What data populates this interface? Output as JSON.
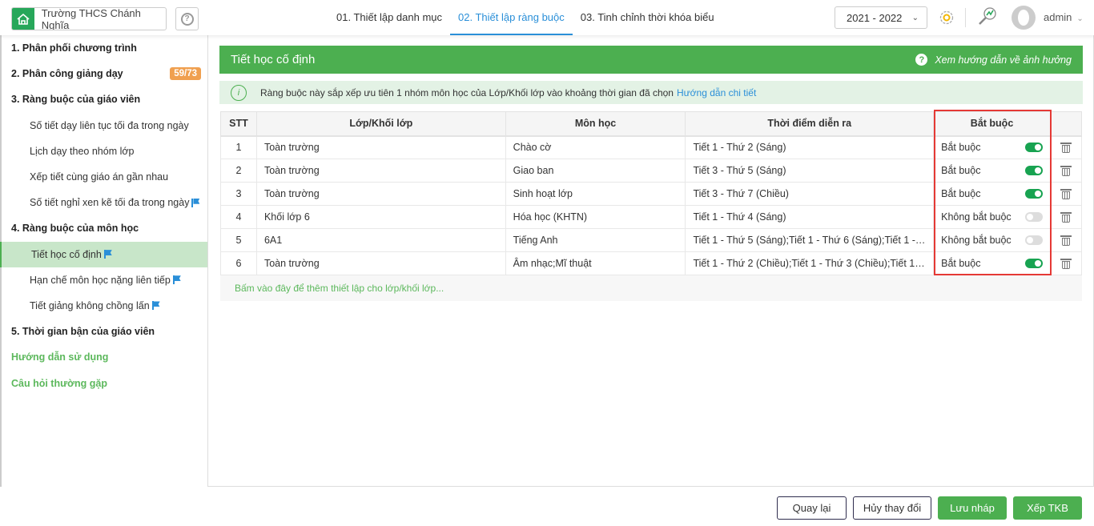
{
  "header": {
    "school": "Trường THCS Chánh Nghĩa",
    "tabs": [
      "01. Thiết lập danh mục",
      "02. Thiết lập ràng buộc",
      "03. Tinh chỉnh thời khóa biểu"
    ],
    "active_tab": 1,
    "year": "2021 - 2022",
    "user": "admin"
  },
  "sidebar": {
    "s1": "1. Phân phối chương trình",
    "s2": "2. Phân công giảng dạy",
    "s2_badge": "59/73",
    "s3": "3. Ràng buộc của giáo viên",
    "s3a": "Số tiết dạy liên tục tối đa trong ngày",
    "s3b": "Lịch dạy theo nhóm lớp",
    "s3c": "Xếp tiết cùng giáo án gần nhau",
    "s3d": "Số tiết nghỉ xen kẽ tối đa trong ngày",
    "s4": "4. Ràng buộc của môn học",
    "s4a": "Tiết học cố định",
    "s4b": "Hạn chế môn học nặng liên tiếp",
    "s4c": "Tiết giảng không chồng lấn",
    "s5": "5. Thời gian bận của giáo viên",
    "guide": "Hướng dẫn sử dụng",
    "faq": "Câu hỏi thường gặp"
  },
  "main": {
    "title": "Tiết học cố định",
    "guide_link": "Xem hướng dẫn về ảnh hưởng",
    "info": "Ràng buộc này sắp xếp ưu tiên 1 nhóm môn học của Lớp/Khối lớp vào khoảng thời gian đã chọn",
    "info_link": "Hướng dẫn chi tiết",
    "columns": [
      "STT",
      "Lớp/Khối lớp",
      "Môn học",
      "Thời điểm diễn ra",
      "Bắt buộc"
    ],
    "rows": [
      {
        "stt": "1",
        "class": "Toàn trường",
        "subject": "Chào cờ",
        "time": "Tiết 1 - Thứ 2 (Sáng)",
        "req": "Bắt buộc",
        "on": true
      },
      {
        "stt": "2",
        "class": "Toàn trường",
        "subject": "Giao ban",
        "time": "Tiết 3 - Thứ 5 (Sáng)",
        "req": "Bắt buộc",
        "on": true
      },
      {
        "stt": "3",
        "class": "Toàn trường",
        "subject": "Sinh hoạt lớp",
        "time": "Tiết 3 - Thứ 7 (Chiều)",
        "req": "Bắt buộc",
        "on": true
      },
      {
        "stt": "4",
        "class": "Khối lớp 6",
        "subject": "Hóa học (KHTN)",
        "time": "Tiết 1 - Thứ 4 (Sáng)",
        "req": "Không bắt buộc",
        "on": false
      },
      {
        "stt": "5",
        "class": "6A1",
        "subject": "Tiếng Anh",
        "time": "Tiết 1 - Thứ 5 (Sáng);Tiết 1 - Thứ 6 (Sáng);Tiết 1 - Th...",
        "req": "Không bắt buộc",
        "on": false
      },
      {
        "stt": "6",
        "class": "Toàn trường",
        "subject": "Âm nhạc;Mĩ thuật",
        "time": "Tiết 1 - Thứ 2 (Chiều);Tiết 1 - Thứ 3 (Chiều);Tiết 1 - T...",
        "req": "Bắt buộc",
        "on": true
      }
    ],
    "add": "Bấm vào đây để thêm thiết lập cho lớp/khối lớp..."
  },
  "footer": {
    "back": "Quay lại",
    "cancel": "Hủy thay đổi",
    "draft": "Lưu nháp",
    "schedule": "Xếp TKB"
  }
}
